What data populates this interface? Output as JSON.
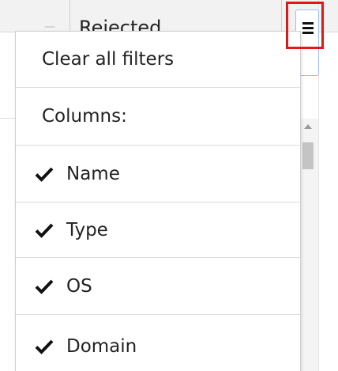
{
  "grid": {
    "header_column_label": "Rejected",
    "sort_hint": "—"
  },
  "menu": {
    "clear_filters_label": "Clear all filters",
    "columns_heading": "Columns:",
    "columns": [
      {
        "label": "Name",
        "checked": true,
        "icon": "checkmark-icon"
      },
      {
        "label": "Type",
        "checked": true,
        "icon": "checkmark-icon"
      },
      {
        "label": "OS",
        "checked": true,
        "icon": "checkmark-icon"
      },
      {
        "label": "Domain",
        "checked": true,
        "icon": "checkmark-icon"
      }
    ]
  },
  "menu_button": {
    "icon": "hamburger-menu-icon"
  },
  "colors": {
    "highlight": "#e01818",
    "button_border": "#9ec1e6",
    "text": "#222222"
  }
}
